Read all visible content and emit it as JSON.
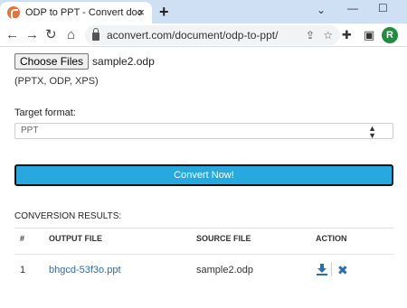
{
  "browser": {
    "tab_title": "ODP to PPT - Convert document",
    "tab_close": "×",
    "new_tab": "+",
    "url": "aconvert.com/document/odp-to-ppt/",
    "profile_initial": "R"
  },
  "upload": {
    "choose_label": "Choose Files",
    "file_name": "sample2.odp",
    "formats_note": "(PPTX, ODP, XPS)"
  },
  "target": {
    "label": "Target format:",
    "value": "PPT"
  },
  "convert_label": "Convert Now!",
  "results": {
    "title": "CONVERSION RESULTS:",
    "headers": [
      "#",
      "OUTPUT FILE",
      "SOURCE FILE",
      "ACTION"
    ],
    "rows": [
      {
        "index": "1",
        "output_file": "bhgcd-53f3o.ppt",
        "source_file": "sample2.odp"
      }
    ]
  },
  "colors": {
    "tabstrip": "#cfe0f5",
    "accent_button": "#27a9df",
    "link": "#2a6db3",
    "avatar": "#1e8e3e"
  },
  "icons": [
    "favicon-icon",
    "close-icon",
    "plus-icon",
    "chevron-down-icon",
    "minimize-icon",
    "maximize-icon",
    "back-icon",
    "forward-icon",
    "reload-icon",
    "home-icon",
    "lock-icon",
    "share-icon",
    "star-icon",
    "extensions-icon",
    "side-panel-icon",
    "download-icon",
    "delete-icon"
  ]
}
